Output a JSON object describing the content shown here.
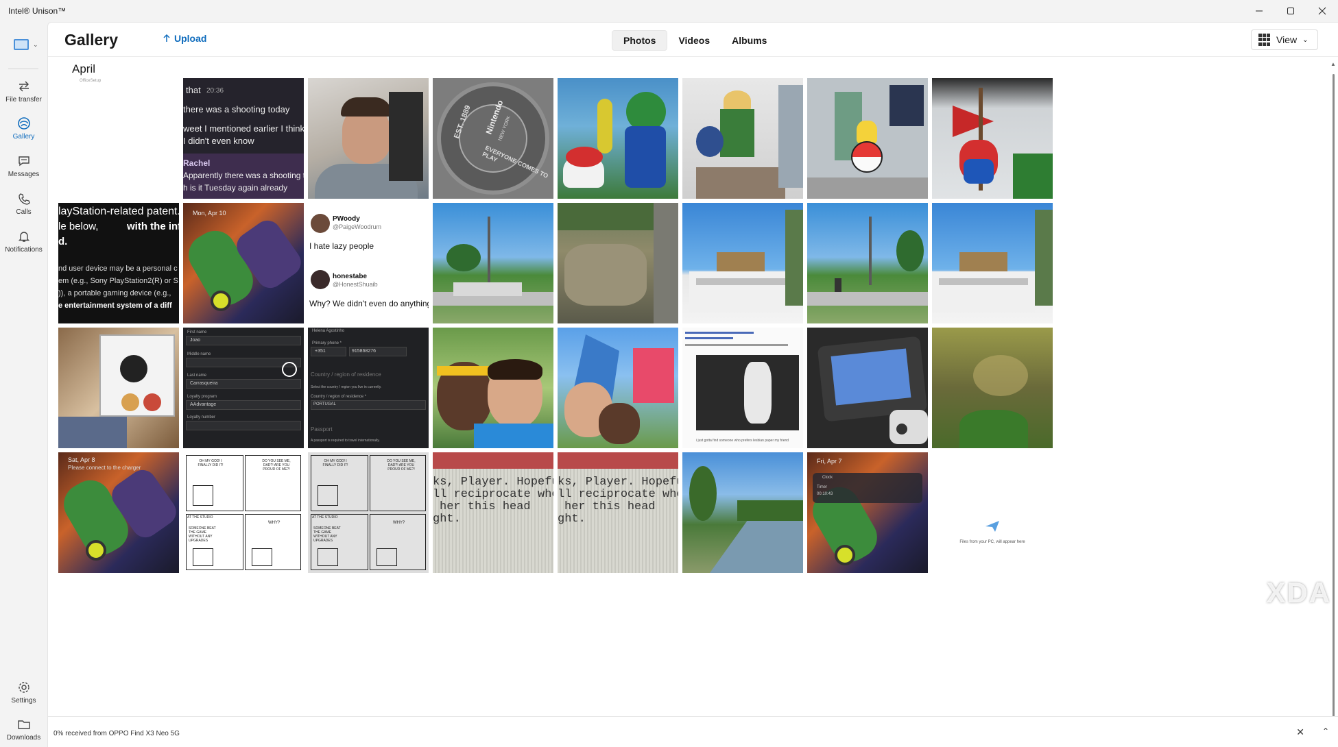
{
  "window": {
    "title": "Intel® Unison™"
  },
  "sidebar": {
    "items": [
      {
        "label": "File transfer",
        "icon": "transfer-icon"
      },
      {
        "label": "Gallery",
        "icon": "gallery-icon"
      },
      {
        "label": "Messages",
        "icon": "message-icon"
      },
      {
        "label": "Calls",
        "icon": "phone-icon"
      },
      {
        "label": "Notifications",
        "icon": "bell-icon"
      }
    ],
    "bottom_items": [
      {
        "label": "Settings",
        "icon": "gear-icon"
      },
      {
        "label": "Downloads",
        "icon": "folder-icon"
      }
    ]
  },
  "header": {
    "title": "Gallery",
    "upload_label": "Upload",
    "tabs": [
      {
        "label": "Photos",
        "active": true
      },
      {
        "label": "Videos",
        "active": false
      },
      {
        "label": "Albums",
        "active": false
      }
    ],
    "view_label": "View"
  },
  "gallery": {
    "month": "April",
    "mini_label": "OfficeSetup",
    "photos": [
      {
        "desc": "chat-screenshot",
        "texts": [
          "that",
          "20:36",
          "there was a shooting today",
          "weet I mentioned earlier I think",
          "I didn't even know",
          "Rachel",
          "Apparently there was a shooting t",
          "h is it Tuesday again already"
        ]
      },
      {
        "desc": "selfie-man-grey-shirt"
      },
      {
        "desc": "nintendo-manhole-cover",
        "texts": [
          "EST. 1889",
          "Nintendo",
          "NEW YORK",
          "EVERYONE COMES TO PLAY"
        ]
      },
      {
        "desc": "luigi-toad-statues"
      },
      {
        "desc": "link-statue-store"
      },
      {
        "desc": "pikachu-pokeball-store"
      },
      {
        "desc": "mario-statue-flag"
      },
      {
        "desc": "patent-text-screenshot",
        "texts": [
          "layStation-related patent.",
          "le below,",
          "with the inflam",
          "d.",
          "nd user device may be a personal c",
          "em (e.g., Sony PlayStation2(R) or S",
          ")), a portable gaming device (e.g.,",
          "e entertainment system of a diff"
        ]
      },
      {
        "desc": "metroid-wallpaper-lockscreen",
        "texts": [
          "Mon, Apr 10"
        ]
      },
      {
        "desc": "tweet-screenshot",
        "texts": [
          "PWoody",
          "@PaigeWoodrum",
          "I hate lazy people",
          "honestabe",
          "@HonestShuaib",
          "Why? We didn't even do anything."
        ]
      },
      {
        "desc": "park-benches"
      },
      {
        "desc": "stream-rocks"
      },
      {
        "desc": "castle-white-houses"
      },
      {
        "desc": "park-benches-2"
      },
      {
        "desc": "castle-white-houses-2"
      },
      {
        "desc": "jigsaw-puzzle-box"
      },
      {
        "desc": "form-dark-screenshot",
        "texts": [
          "First name",
          "Joao",
          "Middle name",
          "Last name",
          "Carrasqueira",
          "Loyalty program",
          "AAdvantage",
          "Loyalty number"
        ]
      },
      {
        "desc": "form-dark-screenshot-2",
        "texts": [
          "Helena Agostinho",
          "Primary phone *",
          "+351",
          "915868276",
          "Country / region of residence",
          "Select the country / region you live in currently.",
          "Country / region of residence *",
          "PORTUGAL",
          "Passport",
          "A passport is required to travel internationally."
        ]
      },
      {
        "desc": "couple-selfie"
      },
      {
        "desc": "couple-selfie-sculpture"
      },
      {
        "desc": "tumblr-post-screenshot",
        "texts": [
          "i just gotta find someone who prefers lesbian paper my friend"
        ]
      },
      {
        "desc": "nintendo-switch-handheld"
      },
      {
        "desc": "murky-water-plants"
      },
      {
        "desc": "metroid-wallpaper-charger",
        "texts": [
          "Sat, Apr 8",
          "Please connect to the charger"
        ]
      },
      {
        "desc": "comic-strip",
        "texts": [
          "OH MY GOD! I FINALLY DID IT!",
          "DO YOU SEE ME, DAD?! ARE YOU PROUD OF ME?!",
          "AT THE STUDIO",
          "WHY?",
          "SOMEONE BEAT THE GAME WITHOUT ANY UPGRADES"
        ]
      },
      {
        "desc": "comic-strip-grey",
        "texts": [
          "OH MY GOD! I FINALLY DID IT!",
          "DO YOU SEE ME, DAD?! ARE YOU PROUD OF ME?!",
          "AT THE STUDIO",
          "WHY?",
          "SOMEONE BEAT THE GAME WITHOUT ANY UPGRADES"
        ]
      },
      {
        "desc": "screen-text-photo",
        "texts": [
          "ks, Player. Hopefu",
          "ll reciprocate whe",
          "her this head",
          "ght."
        ]
      },
      {
        "desc": "screen-text-photo-2",
        "texts": [
          "ks, Player. Hopefu",
          "ll reciprocate whe",
          "her this head",
          "ght."
        ]
      },
      {
        "desc": "river-trees"
      },
      {
        "desc": "metroid-wallpaper-timer",
        "texts": [
          "Fri, Apr 7",
          "Clock",
          "Timer",
          "00:10:43"
        ]
      }
    ],
    "empty_message": "Files from your PC, will appear here"
  },
  "bottom": {
    "transfer_status": "0% received from OPPO Find X3 Neo 5G"
  },
  "watermark": "XDA",
  "colors": {
    "accent": "#0f6cbd"
  }
}
